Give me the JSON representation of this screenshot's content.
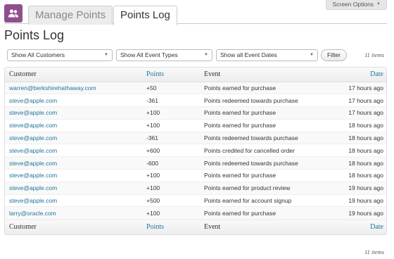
{
  "screen_options": {
    "label": "Screen Options"
  },
  "tabs": [
    {
      "label": "Manage Points"
    },
    {
      "label": "Points Log"
    }
  ],
  "page_title": "Points Log",
  "filters": {
    "customers": "Show All Customers",
    "event_types": "Show All Event Types",
    "event_dates": "Show all Event Dates",
    "filter_button": "Filter"
  },
  "items_count": "11 items",
  "table": {
    "columns": [
      "Customer",
      "Points",
      "Event",
      "Date"
    ],
    "rows": [
      {
        "customer": "warren@berkshirehathaway.com",
        "points": "+50",
        "event": "Points earned for purchase",
        "date": "17 hours ago"
      },
      {
        "customer": "steve@apple.com",
        "points": "-361",
        "event": "Points redeemed towards purchase",
        "date": "17 hours ago"
      },
      {
        "customer": "steve@apple.com",
        "points": "+100",
        "event": "Points earned for purchase",
        "date": "17 hours ago"
      },
      {
        "customer": "steve@apple.com",
        "points": "+100",
        "event": "Points earned for purchase",
        "date": "18 hours ago"
      },
      {
        "customer": "steve@apple.com",
        "points": "-361",
        "event": "Points redeemed towards purchase",
        "date": "18 hours ago"
      },
      {
        "customer": "steve@apple.com",
        "points": "+600",
        "event": "Points credited for cancelled order",
        "date": "18 hours ago"
      },
      {
        "customer": "steve@apple.com",
        "points": "-600",
        "event": "Points redeemed towards purchase",
        "date": "18 hours ago"
      },
      {
        "customer": "steve@apple.com",
        "points": "+100",
        "event": "Points earned for purchase",
        "date": "18 hours ago"
      },
      {
        "customer": "steve@apple.com",
        "points": "+100",
        "event": "Points earned for product review",
        "date": "19 hours ago"
      },
      {
        "customer": "steve@apple.com",
        "points": "+500",
        "event": "Points earned for account signup",
        "date": "19 hours ago"
      },
      {
        "customer": "larry@oracle.com",
        "points": "+100",
        "event": "Points earned for purchase",
        "date": "19 hours ago"
      }
    ]
  }
}
